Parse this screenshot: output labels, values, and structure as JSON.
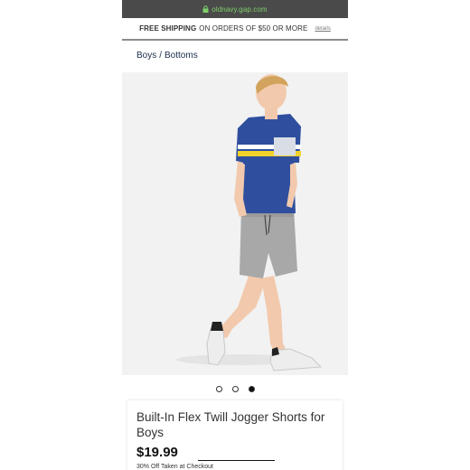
{
  "browser": {
    "url": "oldnavy.gap.com",
    "url_color": "#7ed069",
    "lock_icon": "lock-icon"
  },
  "shipping_banner": {
    "bold_text": "FREE SHIPPING",
    "rest_text": "ON ORDERS OF $50 OR MORE",
    "details_link": "details"
  },
  "breadcrumb": {
    "items": [
      "Boys",
      "Bottoms"
    ],
    "separator": "/"
  },
  "carousel": {
    "total": 3,
    "active_index": 2
  },
  "product": {
    "title": "Built-In Flex Twill Jogger Shorts for Boys",
    "price": "$19.99",
    "promo": "30% Off Taken at Checkout"
  },
  "colors": {
    "accent_navy": "#1a2b4a",
    "shirt_blue": "#2f4f9e",
    "stripe_yellow": "#f2d22a",
    "shorts_gray": "#a8a8a8"
  }
}
